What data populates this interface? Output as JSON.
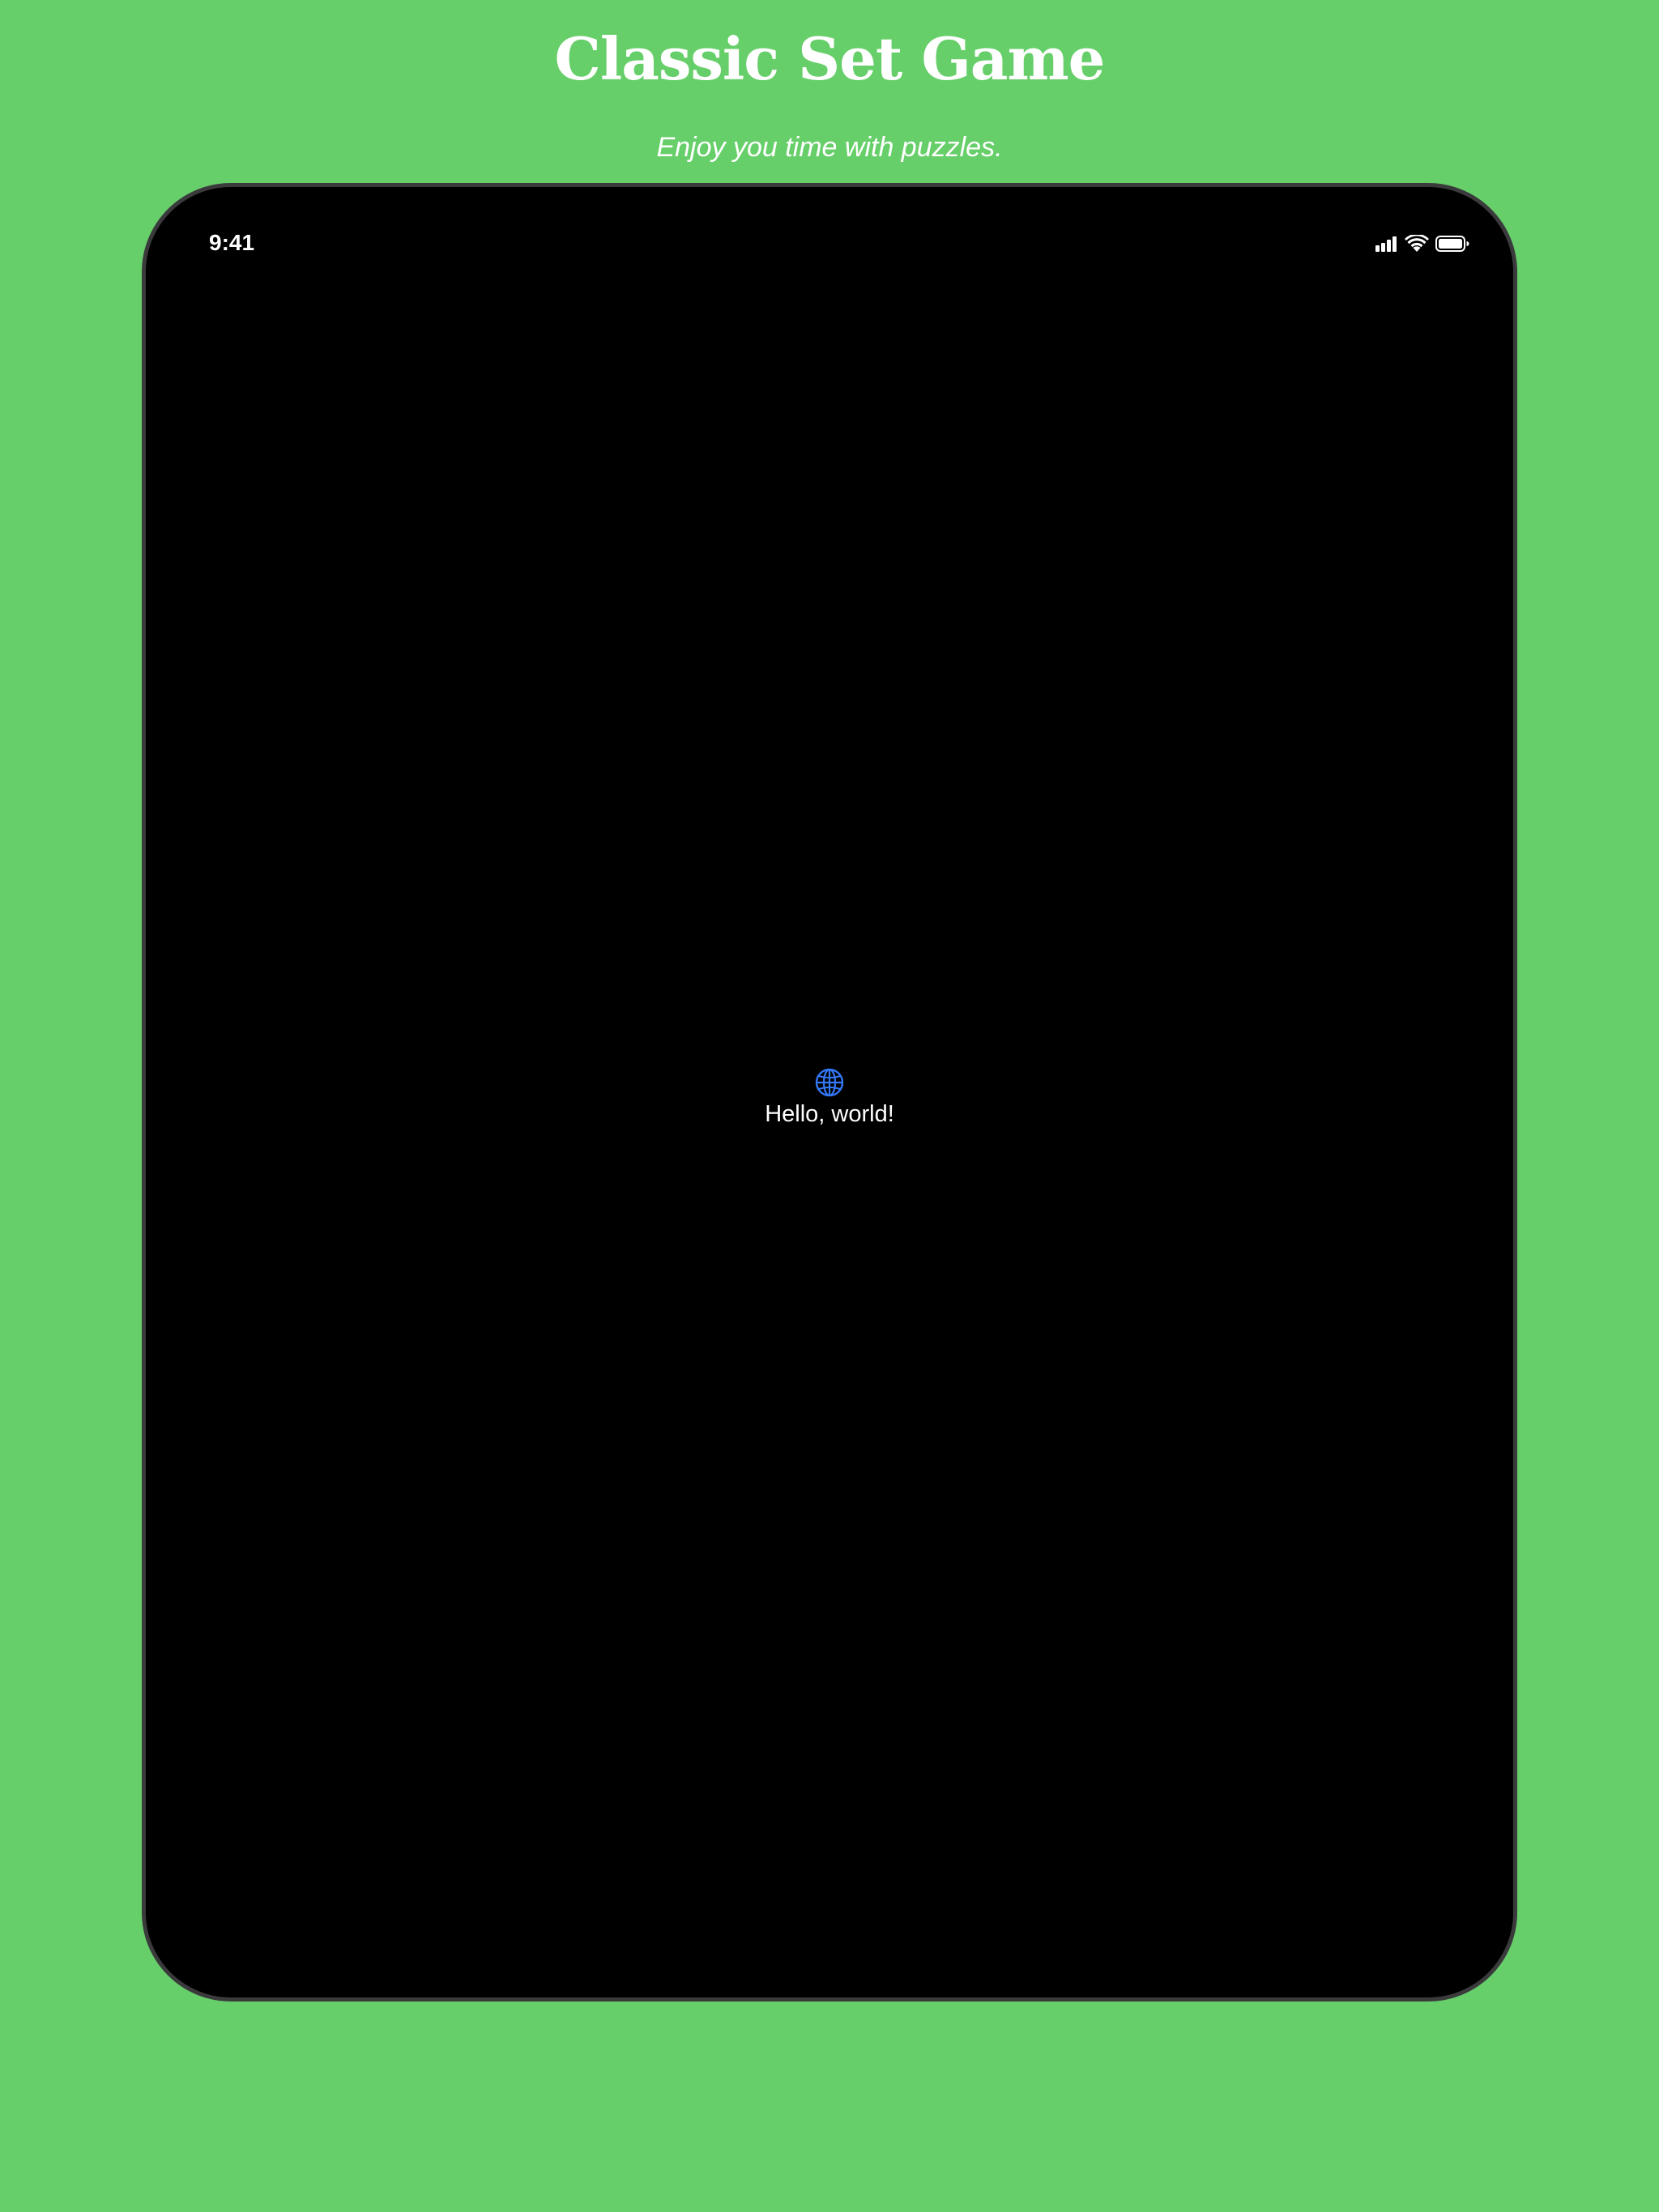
{
  "header": {
    "title": "Classic Set Game",
    "subtitle": "Enjoy you time with puzzles."
  },
  "device": {
    "status_bar": {
      "time": "9:41",
      "icons": [
        "cellular-signal-icon",
        "wifi-icon",
        "battery-icon"
      ]
    },
    "content": {
      "icon": "globe-icon",
      "text": "Hello, world!"
    }
  },
  "colors": {
    "background": "#67cf6a",
    "device_screen": "#000000",
    "device_frame": "#3a3a3c",
    "accent": "#3478f6",
    "text": "#ffffff"
  }
}
